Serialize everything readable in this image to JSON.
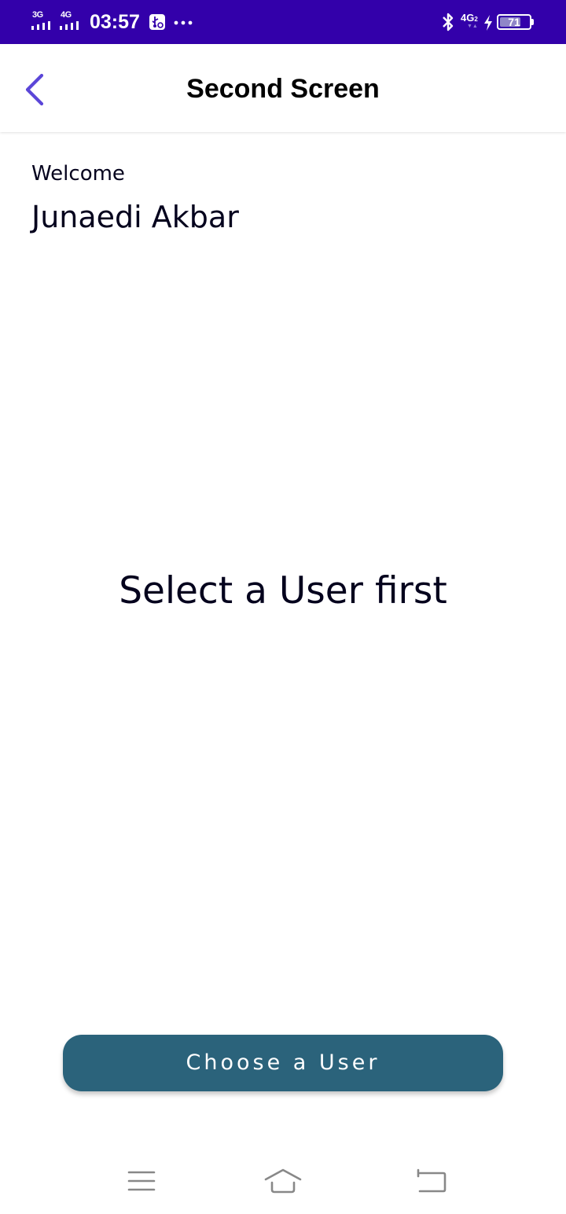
{
  "status_bar": {
    "background": "#3300aa",
    "network_1": "3G",
    "network_2": "4G",
    "time": "03:57",
    "icons": [
      "signal-icon",
      "usb-debug-icon",
      "more-icon",
      "bluetooth-icon",
      "network-4g-icon",
      "charging-icon",
      "battery-icon"
    ],
    "network_4g": "4G",
    "network_4g_sub": "2",
    "battery_level": "71"
  },
  "app_bar": {
    "title": "Second Screen",
    "back_icon": "chevron-left-icon",
    "accent": "#5b46d8"
  },
  "content": {
    "welcome_label": "Welcome",
    "user_name": "Junaedi Akbar",
    "selected_user_text": "Select a User first"
  },
  "actions": {
    "choose_user_label": "Choose a User",
    "button_color": "#2b637b"
  },
  "nav_bar": {
    "icons": [
      "menu-icon",
      "home-icon",
      "back-icon"
    ]
  }
}
